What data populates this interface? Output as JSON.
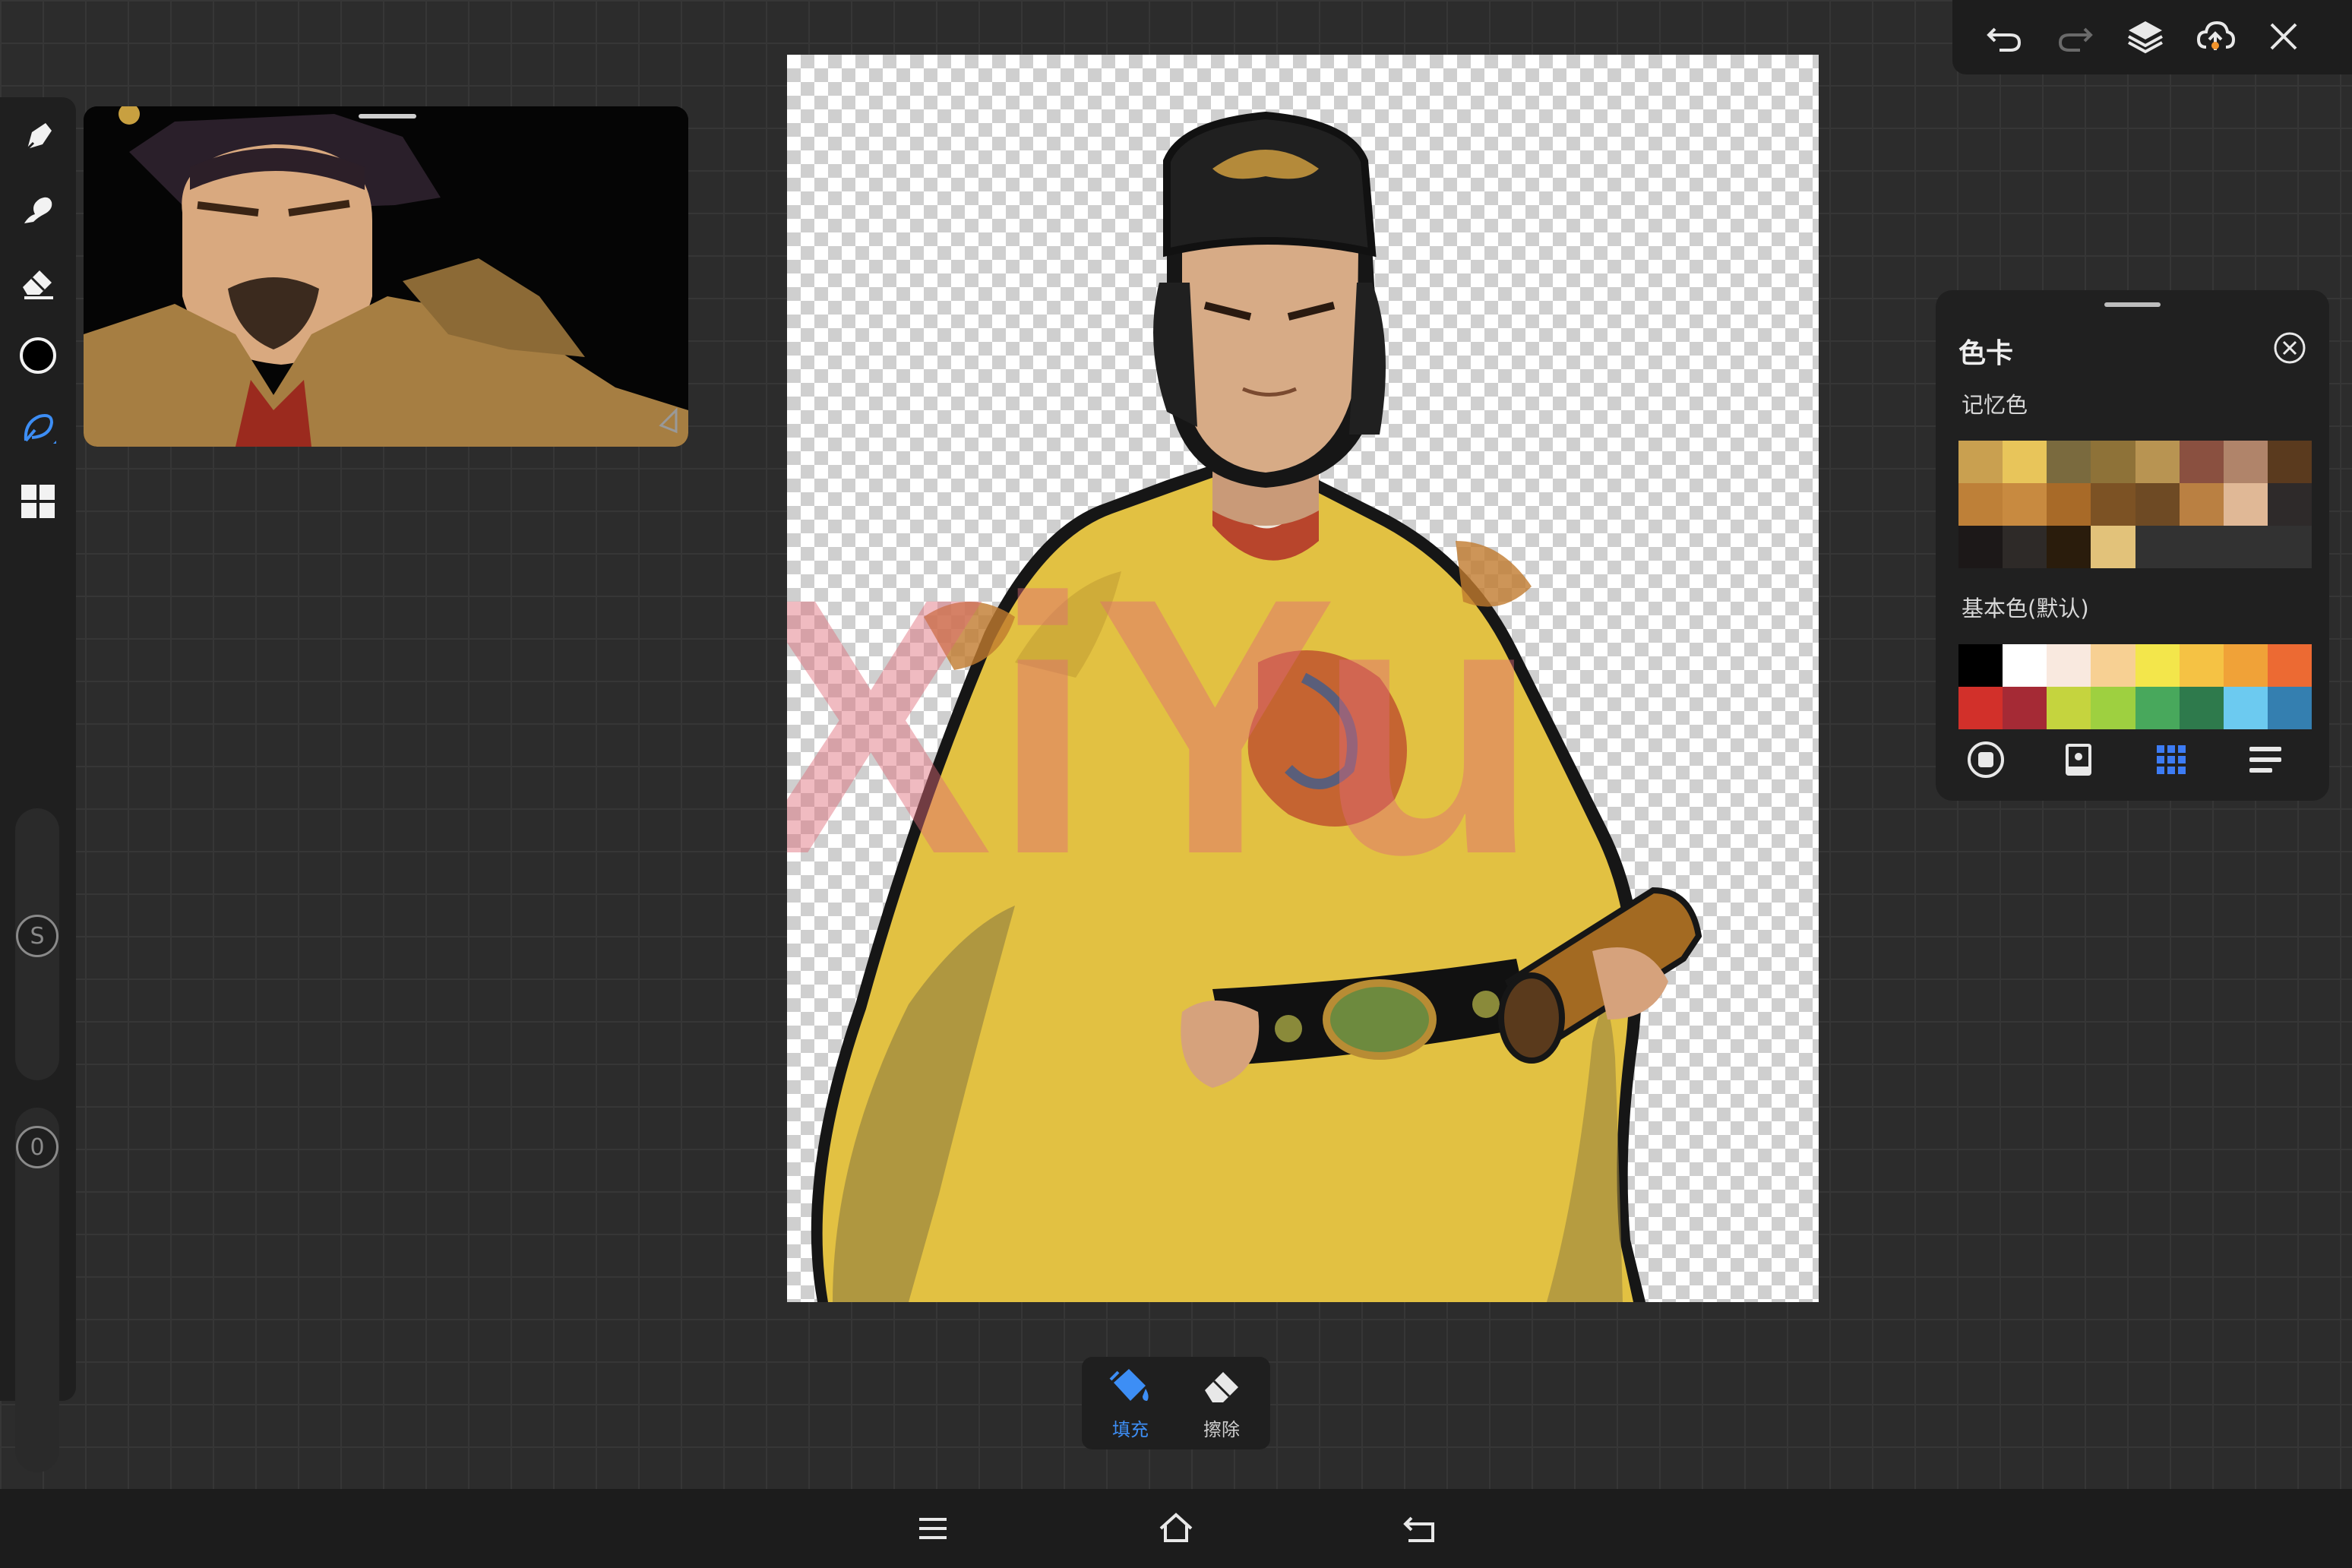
{
  "toolbar": {
    "tools": [
      {
        "name": "brush",
        "icon": "brush-icon"
      },
      {
        "name": "smudge",
        "icon": "smudge-icon"
      },
      {
        "name": "eraser",
        "icon": "eraser-icon"
      },
      {
        "name": "color",
        "icon": "color-circle-icon",
        "color": "#000000"
      },
      {
        "name": "lasso",
        "icon": "lasso-fill-icon",
        "active": true
      },
      {
        "name": "gallery",
        "icon": "grid-icon"
      }
    ],
    "size_label": "S",
    "opacity_label": "0"
  },
  "canvas": {
    "watermark": "XiYu"
  },
  "top_actions": [
    "undo-icon",
    "redo-icon",
    "layers-icon",
    "cloud-upload-icon",
    "close-icon"
  ],
  "color_panel": {
    "title": "色卡",
    "memory_label": "记忆色",
    "memory_colors": [
      "#c9a050",
      "#e8c55a",
      "#7a6a3e",
      "#8e7238",
      "#b89452",
      "#8a5040",
      "#b0846a",
      "#5a3a1e",
      "#be8038",
      "#c88a40",
      "#a86a28",
      "#7c5224",
      "#6e4a24",
      "#ba8042",
      "#e0b896",
      "#2e2a2a",
      "#1c1818",
      "#2e2a28",
      "#2a1c0c",
      "#e2c27a",
      "#323232",
      "#323232",
      "#323232",
      "#323232"
    ],
    "basic_label": "基本色(默认)",
    "basic_colors": [
      "#000000",
      "#ffffff",
      "#f9e9df",
      "#f7d093",
      "#f3e64b",
      "#f5c244",
      "#f0a238",
      "#ec6a33",
      "#d2302a",
      "#a52a35",
      "#c5d43e",
      "#9ed040",
      "#48a85c",
      "#2e7a4c",
      "#6ccaf0",
      "#347fb0"
    ],
    "bottom_icons": [
      "stop-circle-icon",
      "palette-card-icon",
      "grid-dots-icon",
      "list-icon"
    ]
  },
  "fill_erase": {
    "fill_label": "填充",
    "erase_label": "擦除",
    "active_color": "#3d8ef5"
  },
  "nav": [
    "menu-icon",
    "home-icon",
    "back-icon"
  ]
}
